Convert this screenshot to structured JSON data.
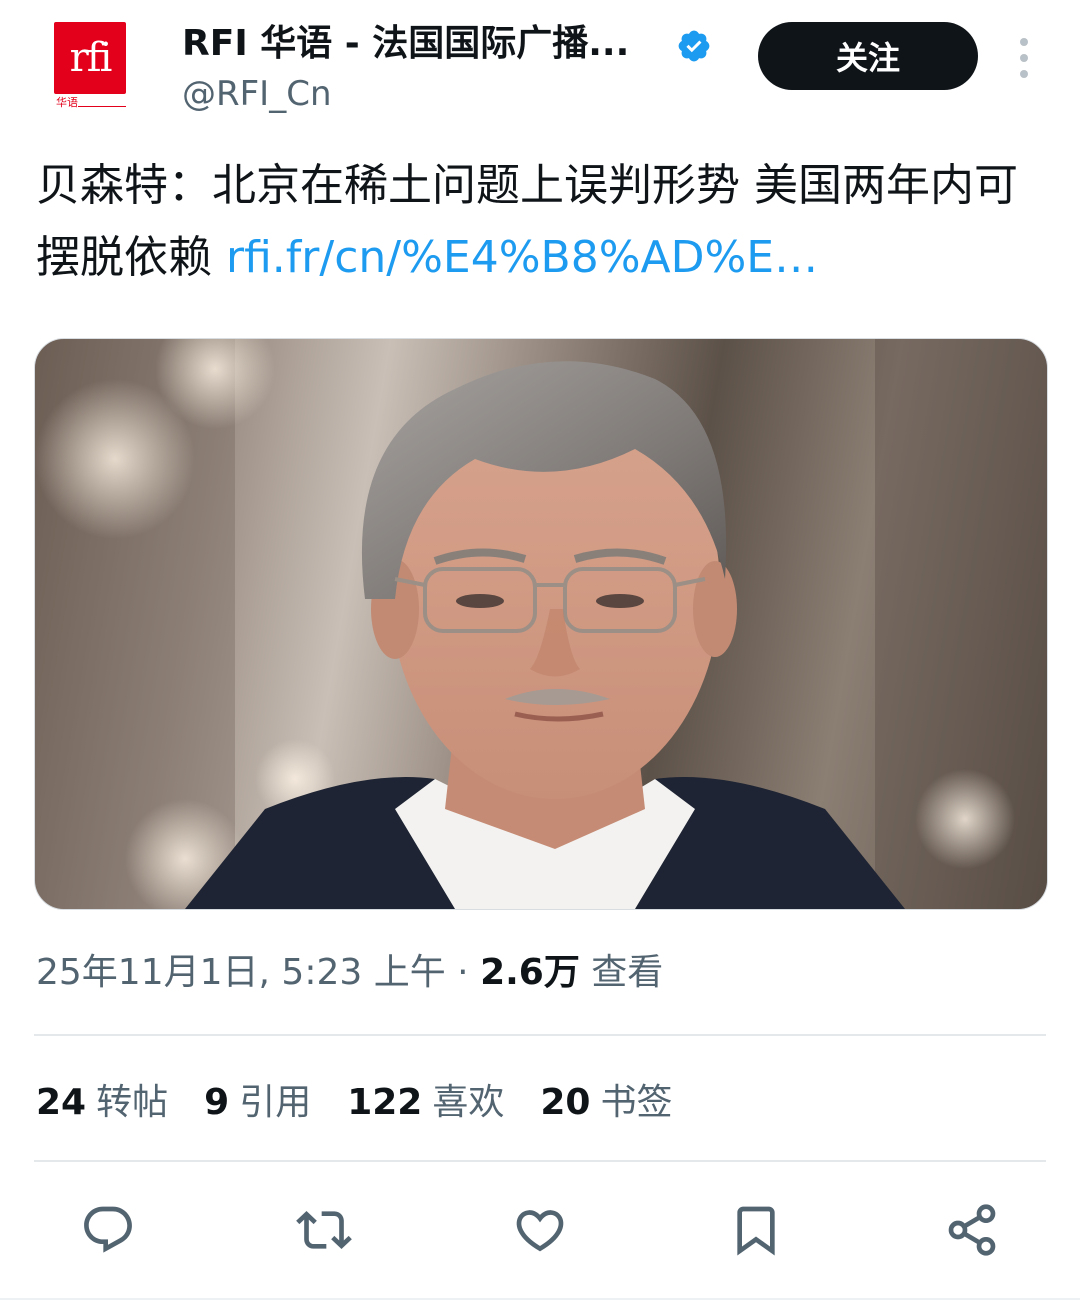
{
  "author": {
    "display_name": "RFI 华语 - 法国国际广播...",
    "handle": "@RFI_Cn",
    "avatar_logo": "rfi",
    "avatar_subtitle": "华语",
    "verified_icon": "verified-badge-icon",
    "brand_color": "#e2001a",
    "verified_color": "#1d9bf0"
  },
  "header": {
    "follow_label": "关注",
    "more_icon": "more-vertical-icon"
  },
  "tweet": {
    "text": "贝森特：北京在稀土问题上误判形势 美国两年内可摆脱依赖",
    "link": "rfi.fr/cn/%E4%B8%AD%E…",
    "link_color": "#1d9bf0"
  },
  "meta": {
    "timestamp": "25年11月1日, 5:23 上午",
    "separator": "·",
    "views_count": "2.6万",
    "views_label": "查看"
  },
  "stats": [
    {
      "count": "24",
      "label": "转帖"
    },
    {
      "count": "9",
      "label": "引用"
    },
    {
      "count": "122",
      "label": "喜欢"
    },
    {
      "count": "20",
      "label": "书签"
    }
  ],
  "actions": [
    {
      "name": "reply",
      "icon": "reply-icon"
    },
    {
      "name": "repost",
      "icon": "repost-icon"
    },
    {
      "name": "like",
      "icon": "like-icon"
    },
    {
      "name": "bookmark",
      "icon": "bookmark-icon"
    },
    {
      "name": "share",
      "icon": "share-icon"
    }
  ]
}
